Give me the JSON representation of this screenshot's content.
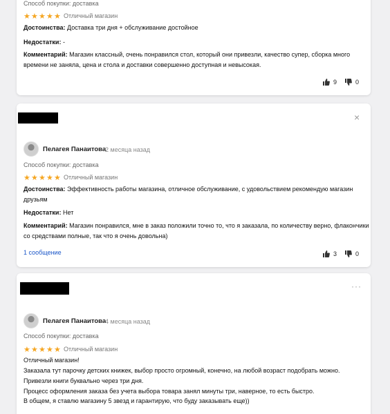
{
  "reviews": [
    {
      "purchase": "Способ покупки: доставка",
      "verdict": "Отличный магазин",
      "pros_label": "Достоинства:",
      "pros": "Доставка три дня + обслуживание достойное",
      "cons_label": "Недостатки:",
      "cons": "-",
      "comment_label": "Комментарий:",
      "comment_line1": "Магазин классный, очень понравился стол, который они привезли, качество супер, сборка много",
      "comment_line2": "времени не заняла, цена и стола и доставки совершенно доступная и невысокая.",
      "likes": "9",
      "dislikes": "0",
      "rating": 5
    },
    {
      "author": "Пелагея Панаитова",
      "date": "2 месяца назад",
      "purchase": "Способ покупки: доставка",
      "verdict": "Отличный магазин",
      "pros_label": "Достоинства:",
      "pros_line1": "Эффективность работы магазина, отличное обслуживание, с удовольствием рекомендую магазин",
      "pros_line2": "друзьям",
      "cons_label": "Недостатки:",
      "cons": "Нет",
      "comment_label": "Комментарий:",
      "comment_line1": "Магазин понравился, мне в заказ положили точно то, что я заказала, по количеству верно, флакончики",
      "comment_line2": "со средствами полные, так что я очень довольна)",
      "messages_link": "1 сообщение",
      "likes": "3",
      "dislikes": "0",
      "rating": 5,
      "close_icon": "×"
    },
    {
      "author": "Пелагея Панаитова",
      "date": "4 месяца назад",
      "purchase": "Способ покупки: доставка",
      "verdict": "Отличный магазин",
      "more_icon": "···",
      "body": [
        "Отличный магазин!",
        "Заказала тут парочку детских книжек, выбор просто огромный, конечно, на любой возраст подобрать можно.",
        "Привезли книги буквально через три дня.",
        "Процесс оформления заказа без учета выбора товара занял минуты три, наверное, то есть быстро.",
        "В общем, я ставлю магазину 5 звезд и гарантирую, что буду заказывать еще))"
      ],
      "rating": 5
    }
  ],
  "colors": {
    "star": "#f5a623",
    "link": "#1a56c8"
  }
}
